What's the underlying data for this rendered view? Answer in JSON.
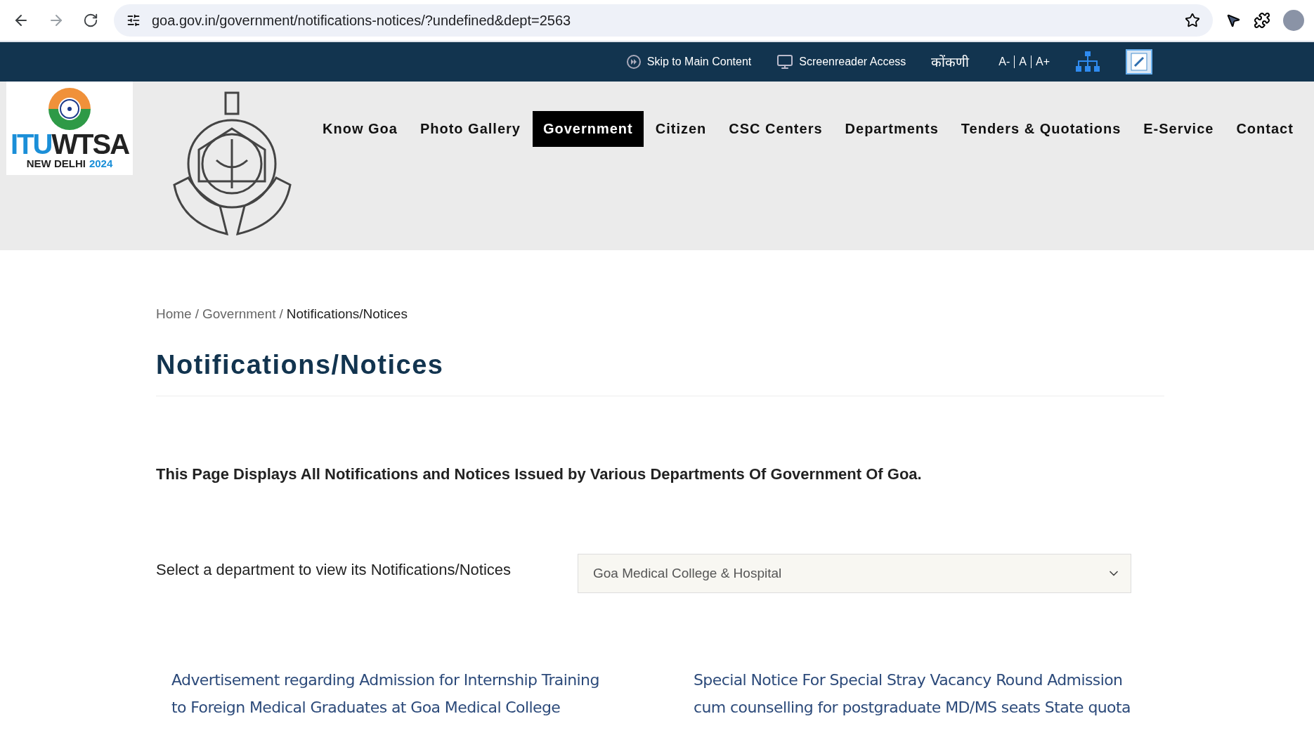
{
  "browser": {
    "url": "goa.gov.in/government/notifications-notices/?undefined&dept=2563"
  },
  "utility_bar": {
    "skip_link": "Skip to Main Content",
    "screenreader": "Screenreader Access",
    "language": "कोंकणी",
    "font_sizes": [
      "A-",
      "A",
      "A+"
    ]
  },
  "logo": {
    "wordmark_left": "ITU",
    "wordmark_right": "WTSA",
    "city": "NEW DELHI",
    "year": "2024"
  },
  "nav": [
    {
      "label": "Know Goa",
      "selected": false
    },
    {
      "label": "Photo Gallery",
      "selected": false
    },
    {
      "label": "Government",
      "selected": true
    },
    {
      "label": "Citizen",
      "selected": false
    },
    {
      "label": "CSC Centers",
      "selected": false
    },
    {
      "label": "Departments",
      "selected": false
    },
    {
      "label": "Tenders & Quotations",
      "selected": false
    },
    {
      "label": "E-Service",
      "selected": false
    },
    {
      "label": "Contact",
      "selected": false
    }
  ],
  "breadcrumb_separator": "/",
  "breadcrumb": [
    {
      "label": "Home",
      "link": true
    },
    {
      "label": "Government",
      "link": true
    },
    {
      "label": "Notifications/Notices",
      "link": false
    }
  ],
  "title": "Notifications/Notices",
  "intro": "This Page Displays All Notifications and Notices Issued by Various Departments Of Government Of Goa.",
  "department_select": {
    "label": "Select a department to view its Notifications/Notices",
    "value": "Goa Medical College & Hospital"
  },
  "notices": [
    {
      "lines": [
        "Advertisement regarding Admission for Internship Training",
        "to Foreign Medical Graduates at Goa Medical College"
      ]
    },
    {
      "lines": [
        "Special Notice For Special Stray Vacancy Round Admission",
        "cum counselling for postgraduate MD/MS seats State quota"
      ]
    }
  ]
}
